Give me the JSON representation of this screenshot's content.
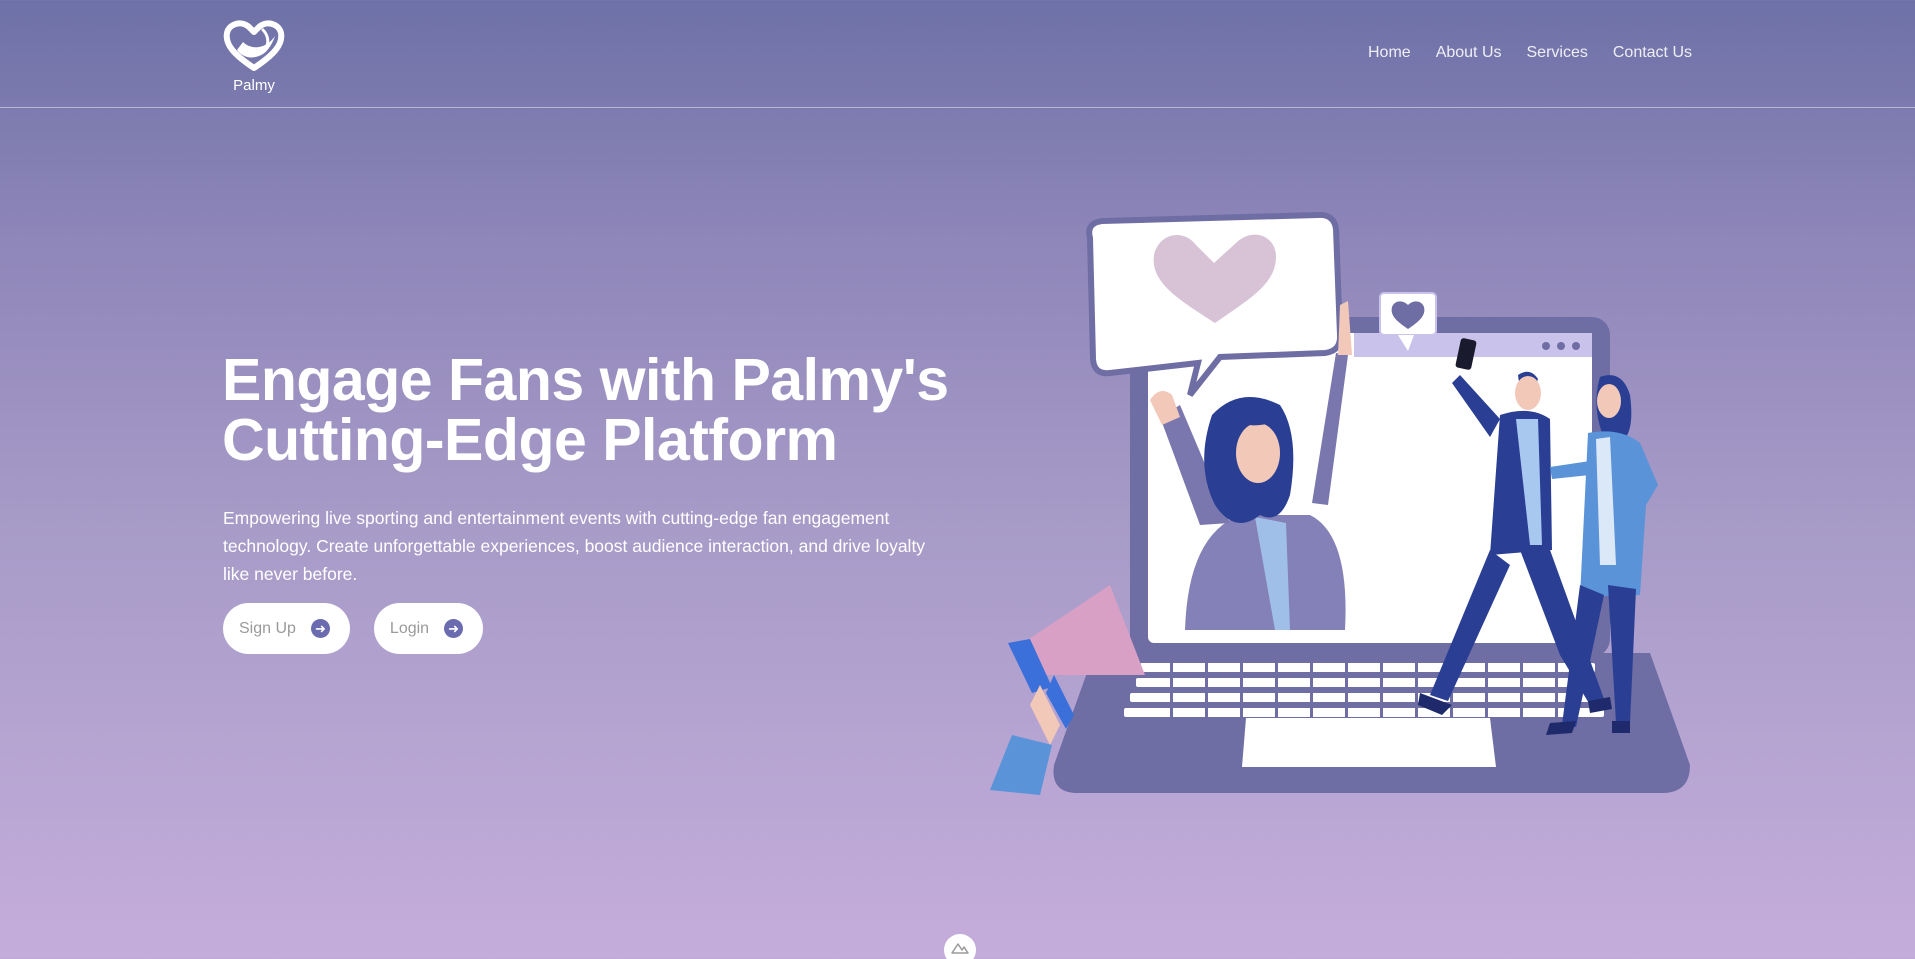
{
  "brand": {
    "name": "Palmy",
    "logo_icon": "heart-hand-icon"
  },
  "nav": {
    "items": [
      {
        "label": "Home"
      },
      {
        "label": "About Us"
      },
      {
        "label": "Services"
      },
      {
        "label": "Contact Us"
      }
    ]
  },
  "hero": {
    "title_line1": "Engage Fans with Palmy's",
    "title_line2": "Cutting-Edge Platform",
    "description": "Empowering live sporting and entertainment events with cutting-edge fan engagement technology. Create unforgettable experiences, boost audience interaction, and drive loyalty like never before.",
    "buttons": [
      {
        "label": "Sign Up",
        "icon": "arrow-right-circle-icon"
      },
      {
        "label": "Login",
        "icon": "arrow-right-circle-icon"
      }
    ]
  },
  "colors": {
    "background_top": "#6d71a7",
    "background_bottom": "#c5addb",
    "accent": "#6b6bb0",
    "laptop": "#6e6da4",
    "character_blue": "#2a3f94",
    "heart_pink": "#d7c2d6"
  },
  "scroll_indicator": {
    "icon": "mountain-icon"
  }
}
